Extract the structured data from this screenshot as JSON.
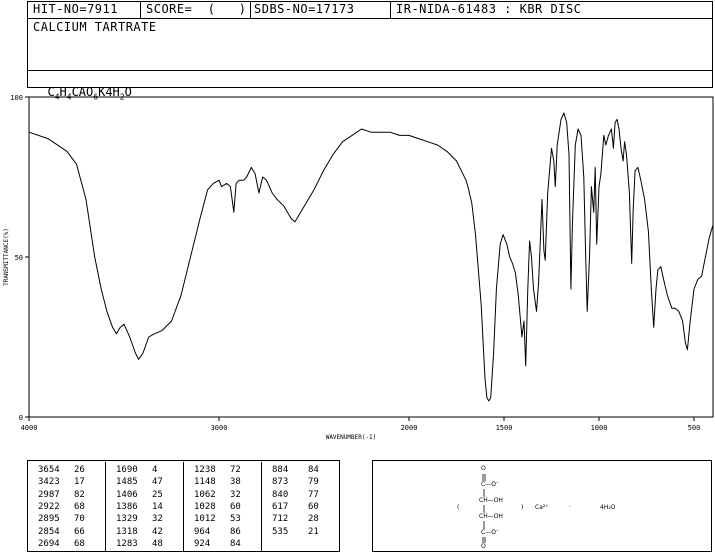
{
  "header": {
    "hit_no": "HIT-NO=7911",
    "score": "SCORE=  (   )",
    "sdbs_no": "SDBS-NO=17173",
    "ir_nida": "IR-NIDA-61483 : KBR DISC",
    "compound_name": "CALCIUM TARTRATE",
    "formula_parts": [
      "C",
      "4",
      "H",
      "4",
      "CAO",
      "6",
      "K4H",
      "2",
      "O"
    ]
  },
  "chart_data": {
    "type": "line",
    "xlabel": "WAVENUMBER(-1)",
    "ylabel": "TRANSMITTANCE(%)",
    "xlim": [
      4000,
      400
    ],
    "ylim": [
      0,
      100
    ],
    "x_ticks": [
      4000,
      3000,
      2000,
      1500,
      1000,
      500
    ],
    "y_ticks": [
      0,
      50,
      100
    ],
    "x_tick_labels": [
      "4000",
      "3000",
      "2000",
      "1500",
      "1000",
      "500"
    ],
    "y_tick_labels": [
      "0",
      "50",
      "100"
    ],
    "series": [
      {
        "points": [
          [
            4000,
            89
          ],
          [
            3900,
            87
          ],
          [
            3800,
            83
          ],
          [
            3750,
            79
          ],
          [
            3700,
            68
          ],
          [
            3654,
            50
          ],
          [
            3620,
            40
          ],
          [
            3590,
            33
          ],
          [
            3560,
            28
          ],
          [
            3540,
            26
          ],
          [
            3520,
            28
          ],
          [
            3500,
            29
          ],
          [
            3470,
            25
          ],
          [
            3440,
            20
          ],
          [
            3423,
            18
          ],
          [
            3400,
            20
          ],
          [
            3370,
            25
          ],
          [
            3340,
            26
          ],
          [
            3300,
            27
          ],
          [
            3250,
            30
          ],
          [
            3200,
            38
          ],
          [
            3150,
            50
          ],
          [
            3100,
            62
          ],
          [
            3060,
            71
          ],
          [
            3030,
            73
          ],
          [
            3000,
            74
          ],
          [
            2987,
            72
          ],
          [
            2960,
            73
          ],
          [
            2940,
            72
          ],
          [
            2922,
            64
          ],
          [
            2910,
            73
          ],
          [
            2895,
            74
          ],
          [
            2870,
            74
          ],
          [
            2854,
            75
          ],
          [
            2830,
            78
          ],
          [
            2810,
            76
          ],
          [
            2790,
            70
          ],
          [
            2770,
            75
          ],
          [
            2750,
            74
          ],
          [
            2720,
            70
          ],
          [
            2694,
            68
          ],
          [
            2660,
            66
          ],
          [
            2620,
            62
          ],
          [
            2600,
            61
          ],
          [
            2580,
            63
          ],
          [
            2550,
            66
          ],
          [
            2500,
            71
          ],
          [
            2450,
            77
          ],
          [
            2400,
            82
          ],
          [
            2350,
            86
          ],
          [
            2300,
            88
          ],
          [
            2250,
            90
          ],
          [
            2200,
            89
          ],
          [
            2150,
            89
          ],
          [
            2100,
            89
          ],
          [
            2050,
            88
          ],
          [
            2000,
            88
          ],
          [
            1950,
            87
          ],
          [
            1900,
            86
          ],
          [
            1850,
            85
          ],
          [
            1800,
            83
          ],
          [
            1750,
            80
          ],
          [
            1700,
            74
          ],
          [
            1690,
            72
          ],
          [
            1670,
            67
          ],
          [
            1650,
            57
          ],
          [
            1620,
            35
          ],
          [
            1600,
            12
          ],
          [
            1590,
            6
          ],
          [
            1580,
            5
          ],
          [
            1570,
            6
          ],
          [
            1555,
            20
          ],
          [
            1540,
            40
          ],
          [
            1520,
            54
          ],
          [
            1505,
            57
          ],
          [
            1485,
            54
          ],
          [
            1470,
            50
          ],
          [
            1455,
            48
          ],
          [
            1440,
            45
          ],
          [
            1425,
            38
          ],
          [
            1410,
            28
          ],
          [
            1406,
            25
          ],
          [
            1395,
            30
          ],
          [
            1386,
            16
          ],
          [
            1375,
            40
          ],
          [
            1365,
            55
          ],
          [
            1355,
            50
          ],
          [
            1345,
            40
          ],
          [
            1329,
            33
          ],
          [
            1318,
            42
          ],
          [
            1300,
            68
          ],
          [
            1290,
            52
          ],
          [
            1283,
            49
          ],
          [
            1270,
            70
          ],
          [
            1250,
            84
          ],
          [
            1238,
            80
          ],
          [
            1230,
            72
          ],
          [
            1220,
            85
          ],
          [
            1200,
            93
          ],
          [
            1185,
            95
          ],
          [
            1170,
            92
          ],
          [
            1158,
            82
          ],
          [
            1148,
            40
          ],
          [
            1140,
            60
          ],
          [
            1125,
            85
          ],
          [
            1110,
            90
          ],
          [
            1095,
            88
          ],
          [
            1080,
            75
          ],
          [
            1070,
            50
          ],
          [
            1062,
            33
          ],
          [
            1050,
            50
          ],
          [
            1040,
            72
          ],
          [
            1028,
            64
          ],
          [
            1020,
            78
          ],
          [
            1012,
            54
          ],
          [
            1000,
            72
          ],
          [
            990,
            76
          ],
          [
            975,
            88
          ],
          [
            964,
            85
          ],
          [
            950,
            88
          ],
          [
            935,
            90
          ],
          [
            924,
            84
          ],
          [
            915,
            92
          ],
          [
            905,
            93
          ],
          [
            895,
            90
          ],
          [
            884,
            84
          ],
          [
            873,
            80
          ],
          [
            865,
            86
          ],
          [
            855,
            82
          ],
          [
            840,
            70
          ],
          [
            828,
            48
          ],
          [
            820,
            65
          ],
          [
            810,
            77
          ],
          [
            795,
            78
          ],
          [
            780,
            74
          ],
          [
            760,
            68
          ],
          [
            740,
            58
          ],
          [
            725,
            40
          ],
          [
            712,
            28
          ],
          [
            700,
            40
          ],
          [
            690,
            46
          ],
          [
            675,
            47
          ],
          [
            660,
            43
          ],
          [
            640,
            38
          ],
          [
            617,
            34
          ],
          [
            600,
            34
          ],
          [
            580,
            33
          ],
          [
            560,
            30
          ],
          [
            545,
            23
          ],
          [
            535,
            21
          ],
          [
            520,
            30
          ],
          [
            500,
            40
          ],
          [
            480,
            43
          ],
          [
            460,
            44
          ],
          [
            440,
            50
          ],
          [
            420,
            56
          ],
          [
            400,
            60
          ]
        ]
      }
    ]
  },
  "peaks": [
    [
      [
        "3654",
        "26"
      ],
      [
        "3423",
        "17"
      ],
      [
        "2987",
        "82"
      ],
      [
        "2922",
        "68"
      ],
      [
        "2895",
        "70"
      ],
      [
        "2854",
        "66"
      ],
      [
        "2694",
        "68"
      ]
    ],
    [
      [
        "1690",
        "4"
      ],
      [
        "1485",
        "47"
      ],
      [
        "1406",
        "25"
      ],
      [
        "1386",
        "14"
      ],
      [
        "1329",
        "32"
      ],
      [
        "1318",
        "42"
      ],
      [
        "1283",
        "48"
      ]
    ],
    [
      [
        "1238",
        "72"
      ],
      [
        "1148",
        "38"
      ],
      [
        "1062",
        "32"
      ],
      [
        "1028",
        "60"
      ],
      [
        "1012",
        "53"
      ],
      [
        "964",
        "86"
      ],
      [
        "924",
        "84"
      ]
    ],
    [
      [
        "884",
        "84"
      ],
      [
        "873",
        "79"
      ],
      [
        "840",
        "77"
      ],
      [
        "617",
        "60"
      ],
      [
        "712",
        "28"
      ],
      [
        "535",
        "21"
      ]
    ]
  ],
  "structure": {
    "o_top": "O",
    "c_o_minus": "C—O⁻",
    "ch_oh_1": "CH—OH",
    "ch_oh_2": "CH—OH",
    "c_o_minus_2": "C—O⁻",
    "o_bottom": "O",
    "open_paren": "(",
    "close_paren": ")",
    "ca": "Ca²⁺",
    "dot": "·",
    "water": "4H₂O"
  }
}
